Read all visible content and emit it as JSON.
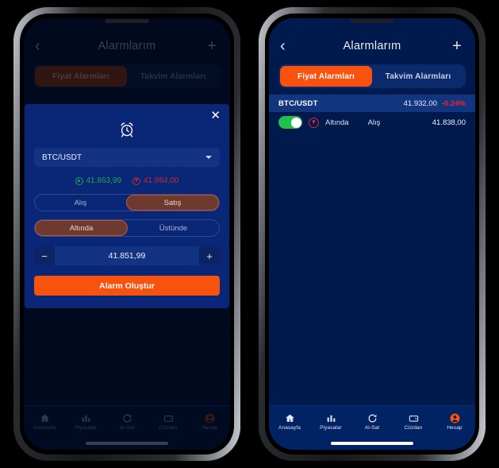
{
  "colors": {
    "accent_orange": "#F9520C",
    "screen_bg": "#001A4E",
    "modal_bg": "#0A2677",
    "up_green": "#1FA64E",
    "down_red": "#C42B33",
    "change_red": "#F4222C",
    "toggle_green": "#21BF4E"
  },
  "header": {
    "back_icon": "chevron-left-icon",
    "title": "Alarmlarım",
    "add_icon": "plus-icon"
  },
  "tabs": [
    {
      "label": "Fiyat Alarmları",
      "active": true
    },
    {
      "label": "Takvim Alarmları",
      "active": false
    }
  ],
  "modal": {
    "close_icon": "close-icon",
    "clock_icon": "alarm-clock-icon",
    "pair_select": {
      "value": "BTC/USDT",
      "caret_icon": "chevron-down-icon"
    },
    "prices": {
      "bid": {
        "icon": "arrow-up-circle-icon",
        "value": "41.863,99"
      },
      "ask": {
        "icon": "arrow-down-circle-icon",
        "value": "41.864,00"
      }
    },
    "side_segment": [
      {
        "label": "Alış",
        "active": false
      },
      {
        "label": "Satış",
        "active": true
      }
    ],
    "direction_segment": [
      {
        "label": "Altında",
        "active": true
      },
      {
        "label": "Üstünde",
        "active": false
      }
    ],
    "stepper": {
      "minus_label": "−",
      "value": "41.851,99",
      "plus_label": "+"
    },
    "submit_label": "Alarm Oluştur"
  },
  "alarm_list": {
    "pair_row": {
      "symbol": "BTC/USDT",
      "price": "41.932,00",
      "change": "-0.24%"
    },
    "alarm_row": {
      "toggle_on": true,
      "direction_icon": "arrow-down-circle-icon",
      "direction_label": "Altında",
      "side_label": "Alış",
      "value": "41.838,00"
    }
  },
  "bottom_nav": [
    {
      "label": "Anasayfa",
      "icon": "home-icon"
    },
    {
      "label": "Piyasalar",
      "icon": "bar-chart-icon"
    },
    {
      "label": "Al-Sat",
      "icon": "refresh-icon"
    },
    {
      "label": "Cüzdan",
      "icon": "wallet-icon"
    },
    {
      "label": "Hesap",
      "icon": "account-circle-icon"
    }
  ]
}
